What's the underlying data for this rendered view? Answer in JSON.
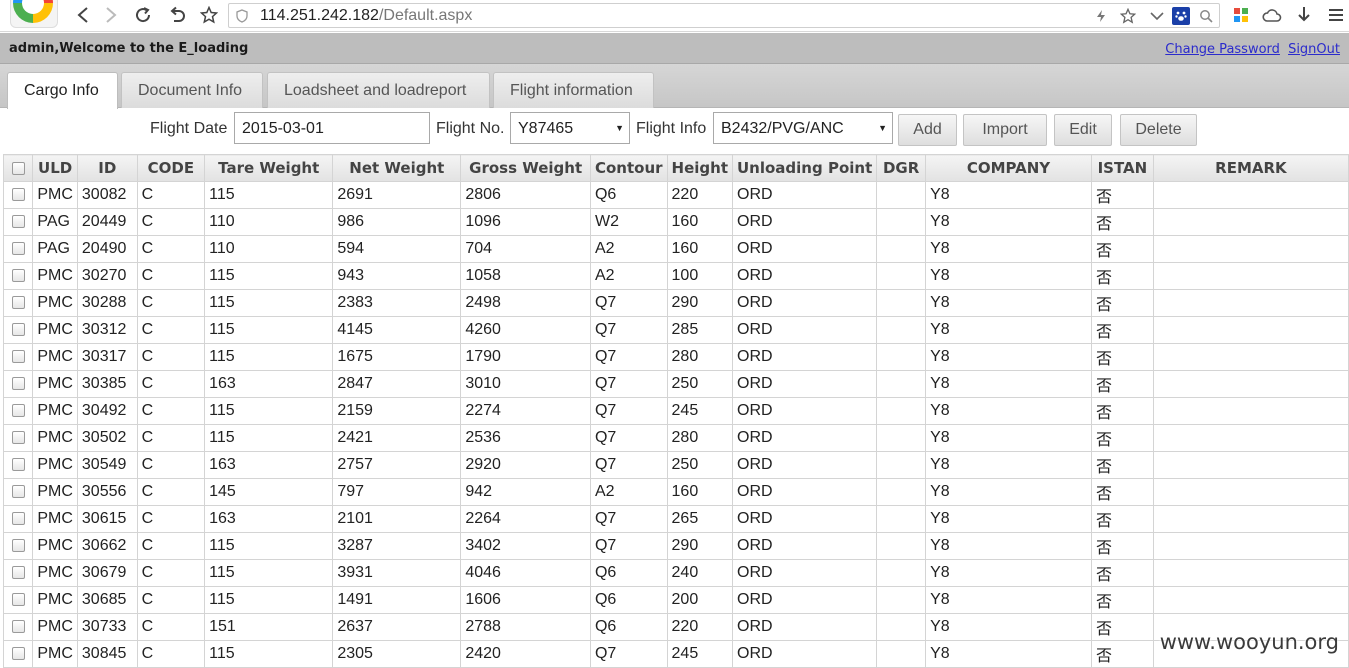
{
  "browser": {
    "url_host": "114.251.242.182",
    "url_path": "/Default.aspx",
    "icons": [
      "back-icon",
      "forward-icon",
      "reload-icon",
      "undo-icon",
      "bookmark-star-icon",
      "shield-icon",
      "lightning-icon",
      "star-icon",
      "chevron-down-icon",
      "paw-icon",
      "search-icon",
      "apps-icon",
      "cloud-icon",
      "download-icon",
      "menu-icon"
    ]
  },
  "header": {
    "welcome": "admin,Welcome to the E_loading",
    "change_password": "Change Password",
    "sign_out": "SignOut"
  },
  "tabs": [
    {
      "label": "Cargo Info",
      "active": true
    },
    {
      "label": "Document Info",
      "active": false
    },
    {
      "label": "Loadsheet and loadreport",
      "active": false
    },
    {
      "label": "Flight information",
      "active": false
    }
  ],
  "filters": {
    "flight_date_label": "Flight Date",
    "flight_date_value": "2015-03-01",
    "flight_no_label": "Flight No.",
    "flight_no_value": "Y87465",
    "flight_info_label": "Flight Info",
    "flight_info_value": "B2432/PVG/ANC",
    "add_label": "Add",
    "import_label": "Import",
    "edit_label": "Edit",
    "delete_label": "Delete"
  },
  "table": {
    "columns": [
      "ULD",
      "ID",
      "CODE",
      "Tare Weight",
      "Net Weight",
      "Gross Weight",
      "Contour",
      "Height",
      "Unloading Point",
      "DGR",
      "COMPANY",
      "ISTAN",
      "REMARK"
    ],
    "rows": [
      [
        "PMC",
        "30082",
        "C",
        "115",
        "2691",
        "2806",
        "Q6",
        "220",
        "ORD",
        "",
        "Y8",
        "否",
        ""
      ],
      [
        "PAG",
        "20449",
        "C",
        "110",
        "986",
        "1096",
        "W2",
        "160",
        "ORD",
        "",
        "Y8",
        "否",
        ""
      ],
      [
        "PAG",
        "20490",
        "C",
        "110",
        "594",
        "704",
        "A2",
        "160",
        "ORD",
        "",
        "Y8",
        "否",
        ""
      ],
      [
        "PMC",
        "30270",
        "C",
        "115",
        "943",
        "1058",
        "A2",
        "100",
        "ORD",
        "",
        "Y8",
        "否",
        ""
      ],
      [
        "PMC",
        "30288",
        "C",
        "115",
        "2383",
        "2498",
        "Q7",
        "290",
        "ORD",
        "",
        "Y8",
        "否",
        ""
      ],
      [
        "PMC",
        "30312",
        "C",
        "115",
        "4145",
        "4260",
        "Q7",
        "285",
        "ORD",
        "",
        "Y8",
        "否",
        ""
      ],
      [
        "PMC",
        "30317",
        "C",
        "115",
        "1675",
        "1790",
        "Q7",
        "280",
        "ORD",
        "",
        "Y8",
        "否",
        ""
      ],
      [
        "PMC",
        "30385",
        "C",
        "163",
        "2847",
        "3010",
        "Q7",
        "250",
        "ORD",
        "",
        "Y8",
        "否",
        ""
      ],
      [
        "PMC",
        "30492",
        "C",
        "115",
        "2159",
        "2274",
        "Q7",
        "245",
        "ORD",
        "",
        "Y8",
        "否",
        ""
      ],
      [
        "PMC",
        "30502",
        "C",
        "115",
        "2421",
        "2536",
        "Q7",
        "280",
        "ORD",
        "",
        "Y8",
        "否",
        ""
      ],
      [
        "PMC",
        "30549",
        "C",
        "163",
        "2757",
        "2920",
        "Q7",
        "250",
        "ORD",
        "",
        "Y8",
        "否",
        ""
      ],
      [
        "PMC",
        "30556",
        "C",
        "145",
        "797",
        "942",
        "A2",
        "160",
        "ORD",
        "",
        "Y8",
        "否",
        ""
      ],
      [
        "PMC",
        "30615",
        "C",
        "163",
        "2101",
        "2264",
        "Q7",
        "265",
        "ORD",
        "",
        "Y8",
        "否",
        ""
      ],
      [
        "PMC",
        "30662",
        "C",
        "115",
        "3287",
        "3402",
        "Q7",
        "290",
        "ORD",
        "",
        "Y8",
        "否",
        ""
      ],
      [
        "PMC",
        "30679",
        "C",
        "115",
        "3931",
        "4046",
        "Q6",
        "240",
        "ORD",
        "",
        "Y8",
        "否",
        ""
      ],
      [
        "PMC",
        "30685",
        "C",
        "115",
        "1491",
        "1606",
        "Q6",
        "200",
        "ORD",
        "",
        "Y8",
        "否",
        ""
      ],
      [
        "PMC",
        "30733",
        "C",
        "151",
        "2637",
        "2788",
        "Q6",
        "220",
        "ORD",
        "",
        "Y8",
        "否",
        ""
      ],
      [
        "PMC",
        "30845",
        "C",
        "115",
        "2305",
        "2420",
        "Q7",
        "245",
        "ORD",
        "",
        "Y8",
        "否",
        ""
      ]
    ]
  },
  "watermark": "www.wooyun.org",
  "colors": {
    "header_bg": "#bdbdbd",
    "link": "#2b2bcc",
    "tab_strip": "#cccccc"
  }
}
